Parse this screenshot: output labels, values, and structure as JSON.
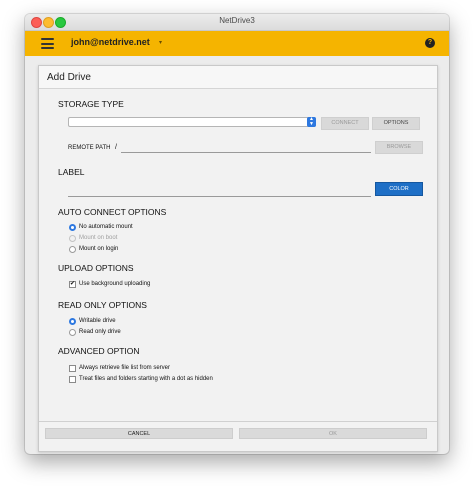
{
  "window": {
    "title": "NetDrive3"
  },
  "appbar": {
    "account": "john@netdrive.net",
    "caret": "▾",
    "help": "?"
  },
  "panel": {
    "title": "Add Drive"
  },
  "storage": {
    "heading": "STORAGE TYPE",
    "selected": "",
    "connect_label": "CONNECT",
    "options_label": "OPTIONS"
  },
  "remote": {
    "label": "REMOTE PATH",
    "value": "/",
    "browse_label": "BROWSE"
  },
  "label_section": {
    "heading": "LABEL",
    "value": "",
    "color_label": "COLOR"
  },
  "auto_connect": {
    "heading": "AUTO CONNECT OPTIONS",
    "options": [
      {
        "label": "No automatic mount",
        "selected": true,
        "enabled": true
      },
      {
        "label": "Mount on boot",
        "selected": false,
        "enabled": false
      },
      {
        "label": "Mount on login",
        "selected": false,
        "enabled": true
      }
    ]
  },
  "upload": {
    "heading": "UPLOAD OPTIONS",
    "background_label": "Use background uploading",
    "background_checked": true
  },
  "read_only": {
    "heading": "READ ONLY OPTIONS",
    "options": [
      {
        "label": "Writable drive",
        "selected": true
      },
      {
        "label": "Read only drive",
        "selected": false
      }
    ]
  },
  "advanced": {
    "heading": "ADVANCED OPTION",
    "always_retrieve_label": "Always retrieve file list from server",
    "always_retrieve_checked": false,
    "dot_hidden_label": "Treat files and folders starting with a dot as hidden",
    "dot_hidden_checked": false
  },
  "footer": {
    "cancel_label": "CANCEL",
    "ok_label": "OK"
  },
  "colors": {
    "accent": "#F5B400",
    "primary": "#1E6FC6",
    "radio": "#2D78E0"
  }
}
